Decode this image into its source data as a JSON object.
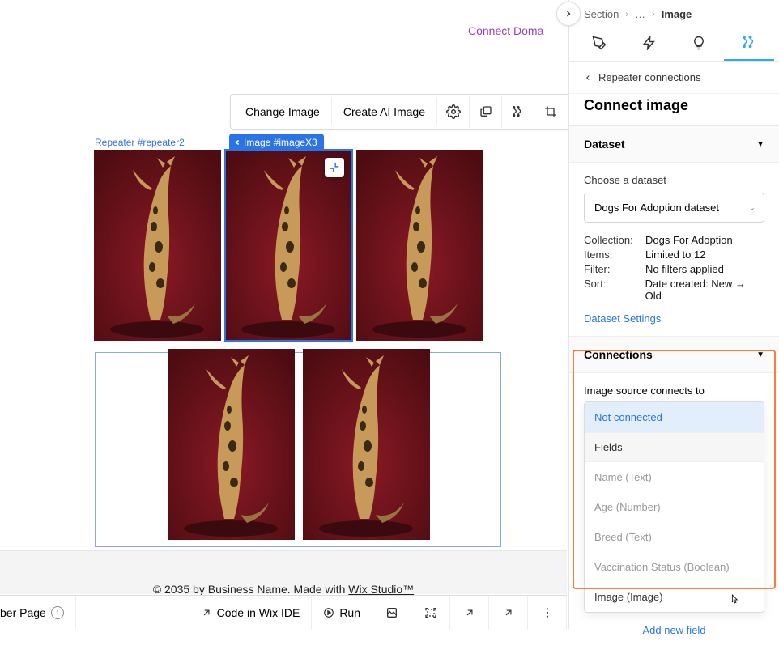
{
  "top": {
    "connect_domain": "Connect Doma"
  },
  "action_bar": {
    "change_image": "Change Image",
    "create_ai": "Create AI Image"
  },
  "labels": {
    "repeater": "Repeater #repeater2",
    "image_tag": "Image #imageX3"
  },
  "footer": {
    "prefix": "© 2035 by Business Name. Made with ",
    "link": "Wix Studio™"
  },
  "bottom": {
    "page": "ber Page",
    "code": "Code in Wix IDE",
    "run": "Run"
  },
  "panel": {
    "breadcrumb": {
      "a": "Section",
      "dots": "…",
      "c": "Image"
    },
    "back": "Repeater connections",
    "title": "Connect image",
    "dataset_hd": "Dataset",
    "choose": "Choose a dataset",
    "dataset_selected": "Dogs For Adoption dataset",
    "kv": {
      "collection_k": "Collection:",
      "collection_v": "Dogs For Adoption",
      "items_k": "Items:",
      "items_v": "Limited to 12",
      "filter_k": "Filter:",
      "filter_v": "No filters applied",
      "sort_k": "Sort:",
      "sort_v": "Date created: New → Old"
    },
    "dataset_settings": "Dataset Settings",
    "connections_hd": "Connections",
    "connects_lbl": "Image source connects to",
    "dropdown": {
      "not_connected": "Not connected",
      "fields_hd": "Fields",
      "f1": "Name (Text)",
      "f2": "Age (Number)",
      "f3": "Breed (Text)",
      "f4": "Vaccination Status (Boolean)",
      "f5": "Image (Image)"
    },
    "add_new": "Add new field"
  }
}
